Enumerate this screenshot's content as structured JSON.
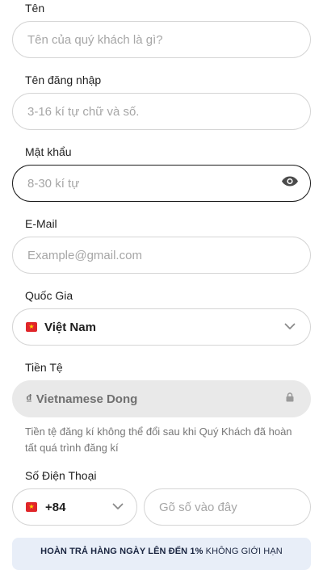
{
  "name": {
    "label": "Tên",
    "placeholder": "Tên của quý khách là gì?"
  },
  "username": {
    "label": "Tên đăng nhập",
    "placeholder": "3-16 kí tự chữ và số."
  },
  "password": {
    "label": "Mật khẩu",
    "placeholder": "8-30 kí tự",
    "icon": "eye-icon"
  },
  "email": {
    "label": "E-Mail",
    "placeholder": "Example@gmail.com"
  },
  "country": {
    "label": "Quốc Gia",
    "value": "Việt Nam",
    "flag_color": "#e0262a"
  },
  "currency": {
    "label": "Tiền Tệ",
    "symbol": "₫",
    "value": "Vietnamese Dong",
    "helper": "Tiền tệ đăng kí không thể đổi sau khi Quý Khách đã hoàn tất quá trình đăng kí"
  },
  "phone": {
    "label": "Số Điện Thoại",
    "code": "+84",
    "placeholder": "Gõ số vào đây"
  },
  "banner": {
    "bold_text": "HOÀN TRẢ HÀNG NGÀY LÊN ĐẾN 1%",
    "text": " KHÔNG GIỚI HẠN"
  }
}
